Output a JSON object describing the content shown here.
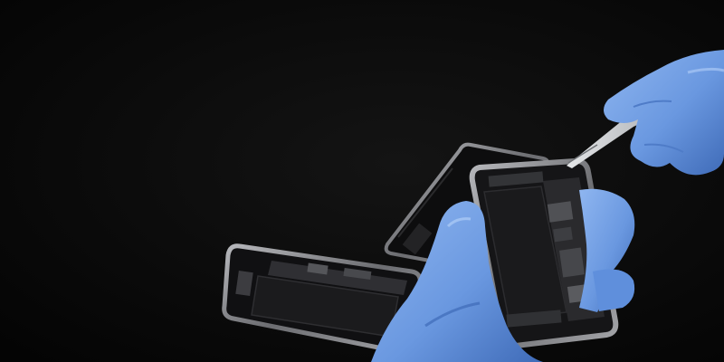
{
  "scene": {
    "subject": "phone-repair",
    "colors": {
      "background": "#050505",
      "glove": "#6f9fe6",
      "glove_shadow": "#3f6fbf",
      "glove_highlight": "#a9c8f5",
      "phone_frame": "#8c8c90",
      "phone_frame_dark": "#3a3a3d",
      "battery": "#1a1a1c",
      "board": "#2b2b2e",
      "chip": "#4a4a4e",
      "tweezers": "#bfc2c6"
    }
  }
}
